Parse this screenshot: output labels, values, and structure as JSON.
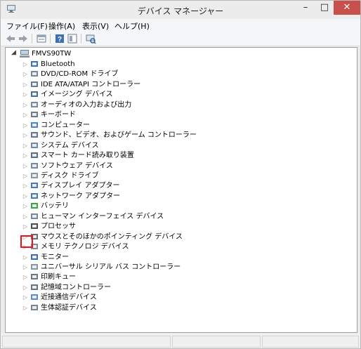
{
  "window": {
    "title": "デバイス マネージャー",
    "controls": {
      "minimize": "–",
      "maximize": "□",
      "close": "✕"
    }
  },
  "menu": [
    {
      "label": "ファイル(F)"
    },
    {
      "label": "操作(A)"
    },
    {
      "label": "表示(V)"
    },
    {
      "label": "ヘルプ(H)"
    }
  ],
  "toolbar": {
    "buttons": [
      "back-icon",
      "forward-icon",
      "properties-pane-icon",
      "help-icon",
      "show-hide-icon",
      "scan-hardware-icon"
    ]
  },
  "tree": {
    "root": {
      "label": "FMVS90TW",
      "expanded": true
    },
    "items": [
      {
        "label": "Bluetooth",
        "icon": "bluetooth-icon"
      },
      {
        "label": "DVD/CD-ROM ドライブ",
        "icon": "dvd-drive-icon"
      },
      {
        "label": "IDE ATA/ATAPI コントローラー",
        "icon": "ide-controller-icon"
      },
      {
        "label": "イメージング デバイス",
        "icon": "imaging-device-icon"
      },
      {
        "label": "オーディオの入力および出力",
        "icon": "audio-icon"
      },
      {
        "label": "キーボード",
        "icon": "keyboard-icon"
      },
      {
        "label": "コンピューター",
        "icon": "computer-icon"
      },
      {
        "label": "サウンド、ビデオ、およびゲーム コントローラー",
        "icon": "sound-icon"
      },
      {
        "label": "システム デバイス",
        "icon": "system-device-icon"
      },
      {
        "label": "スマート カード読み取り装置",
        "icon": "smart-card-icon"
      },
      {
        "label": "ソフトウェア デバイス",
        "icon": "software-device-icon"
      },
      {
        "label": "ディスク ドライブ",
        "icon": "disk-drive-icon"
      },
      {
        "label": "ディスプレイ アダプター",
        "icon": "display-adapter-icon"
      },
      {
        "label": "ネットワーク アダプター",
        "icon": "network-adapter-icon"
      },
      {
        "label": "バッテリ",
        "icon": "battery-icon"
      },
      {
        "label": "ヒューマン インターフェイス デバイス",
        "icon": "hid-icon"
      },
      {
        "label": "プロセッサ",
        "icon": "processor-icon"
      },
      {
        "label": "マウスとそのほかのポインティング デバイス",
        "icon": "mouse-icon"
      },
      {
        "label": "メモリ テクノロジ デバイス",
        "icon": "memory-icon"
      },
      {
        "label": "モニター",
        "icon": "monitor-icon"
      },
      {
        "label": "ユニバーサル シリアル バス コントローラー",
        "icon": "usb-icon"
      },
      {
        "label": "印刷キュー",
        "icon": "printer-icon"
      },
      {
        "label": "記憶域コントローラー",
        "icon": "storage-controller-icon"
      },
      {
        "label": "近接通信デバイス",
        "icon": "proximity-icon"
      },
      {
        "label": "生体認証デバイス",
        "icon": "biometric-icon"
      }
    ]
  },
  "highlight_color": "#e8141b"
}
